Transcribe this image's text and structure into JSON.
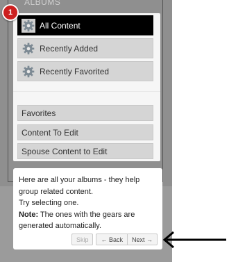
{
  "albums": {
    "heading": "ALBUMS",
    "generated_items": [
      {
        "label": "All Content",
        "icon": "gear-icon",
        "active": true
      },
      {
        "label": "Recently Added",
        "icon": "gear-icon",
        "active": false
      },
      {
        "label": "Recently Favorited",
        "icon": "gear-icon",
        "active": false
      }
    ],
    "user_items": [
      {
        "label": "Favorites"
      },
      {
        "label": "Content To Edit"
      },
      {
        "label": "Spouse Content to Edit"
      }
    ]
  },
  "tour": {
    "step": "1",
    "line1": "Here are all your albums - they help",
    "line2": "group related content.",
    "line3": "Try selecting one.",
    "note_label": "Note:",
    "note_text": " The ones with the gears are",
    "line5": "generated automatically.",
    "skip_label": "Skip",
    "back_label": "← Back",
    "next_label": "Next →"
  },
  "colors": {
    "badge": "#cc2020",
    "active_item": "#000000",
    "item": "#d5d5d5"
  }
}
